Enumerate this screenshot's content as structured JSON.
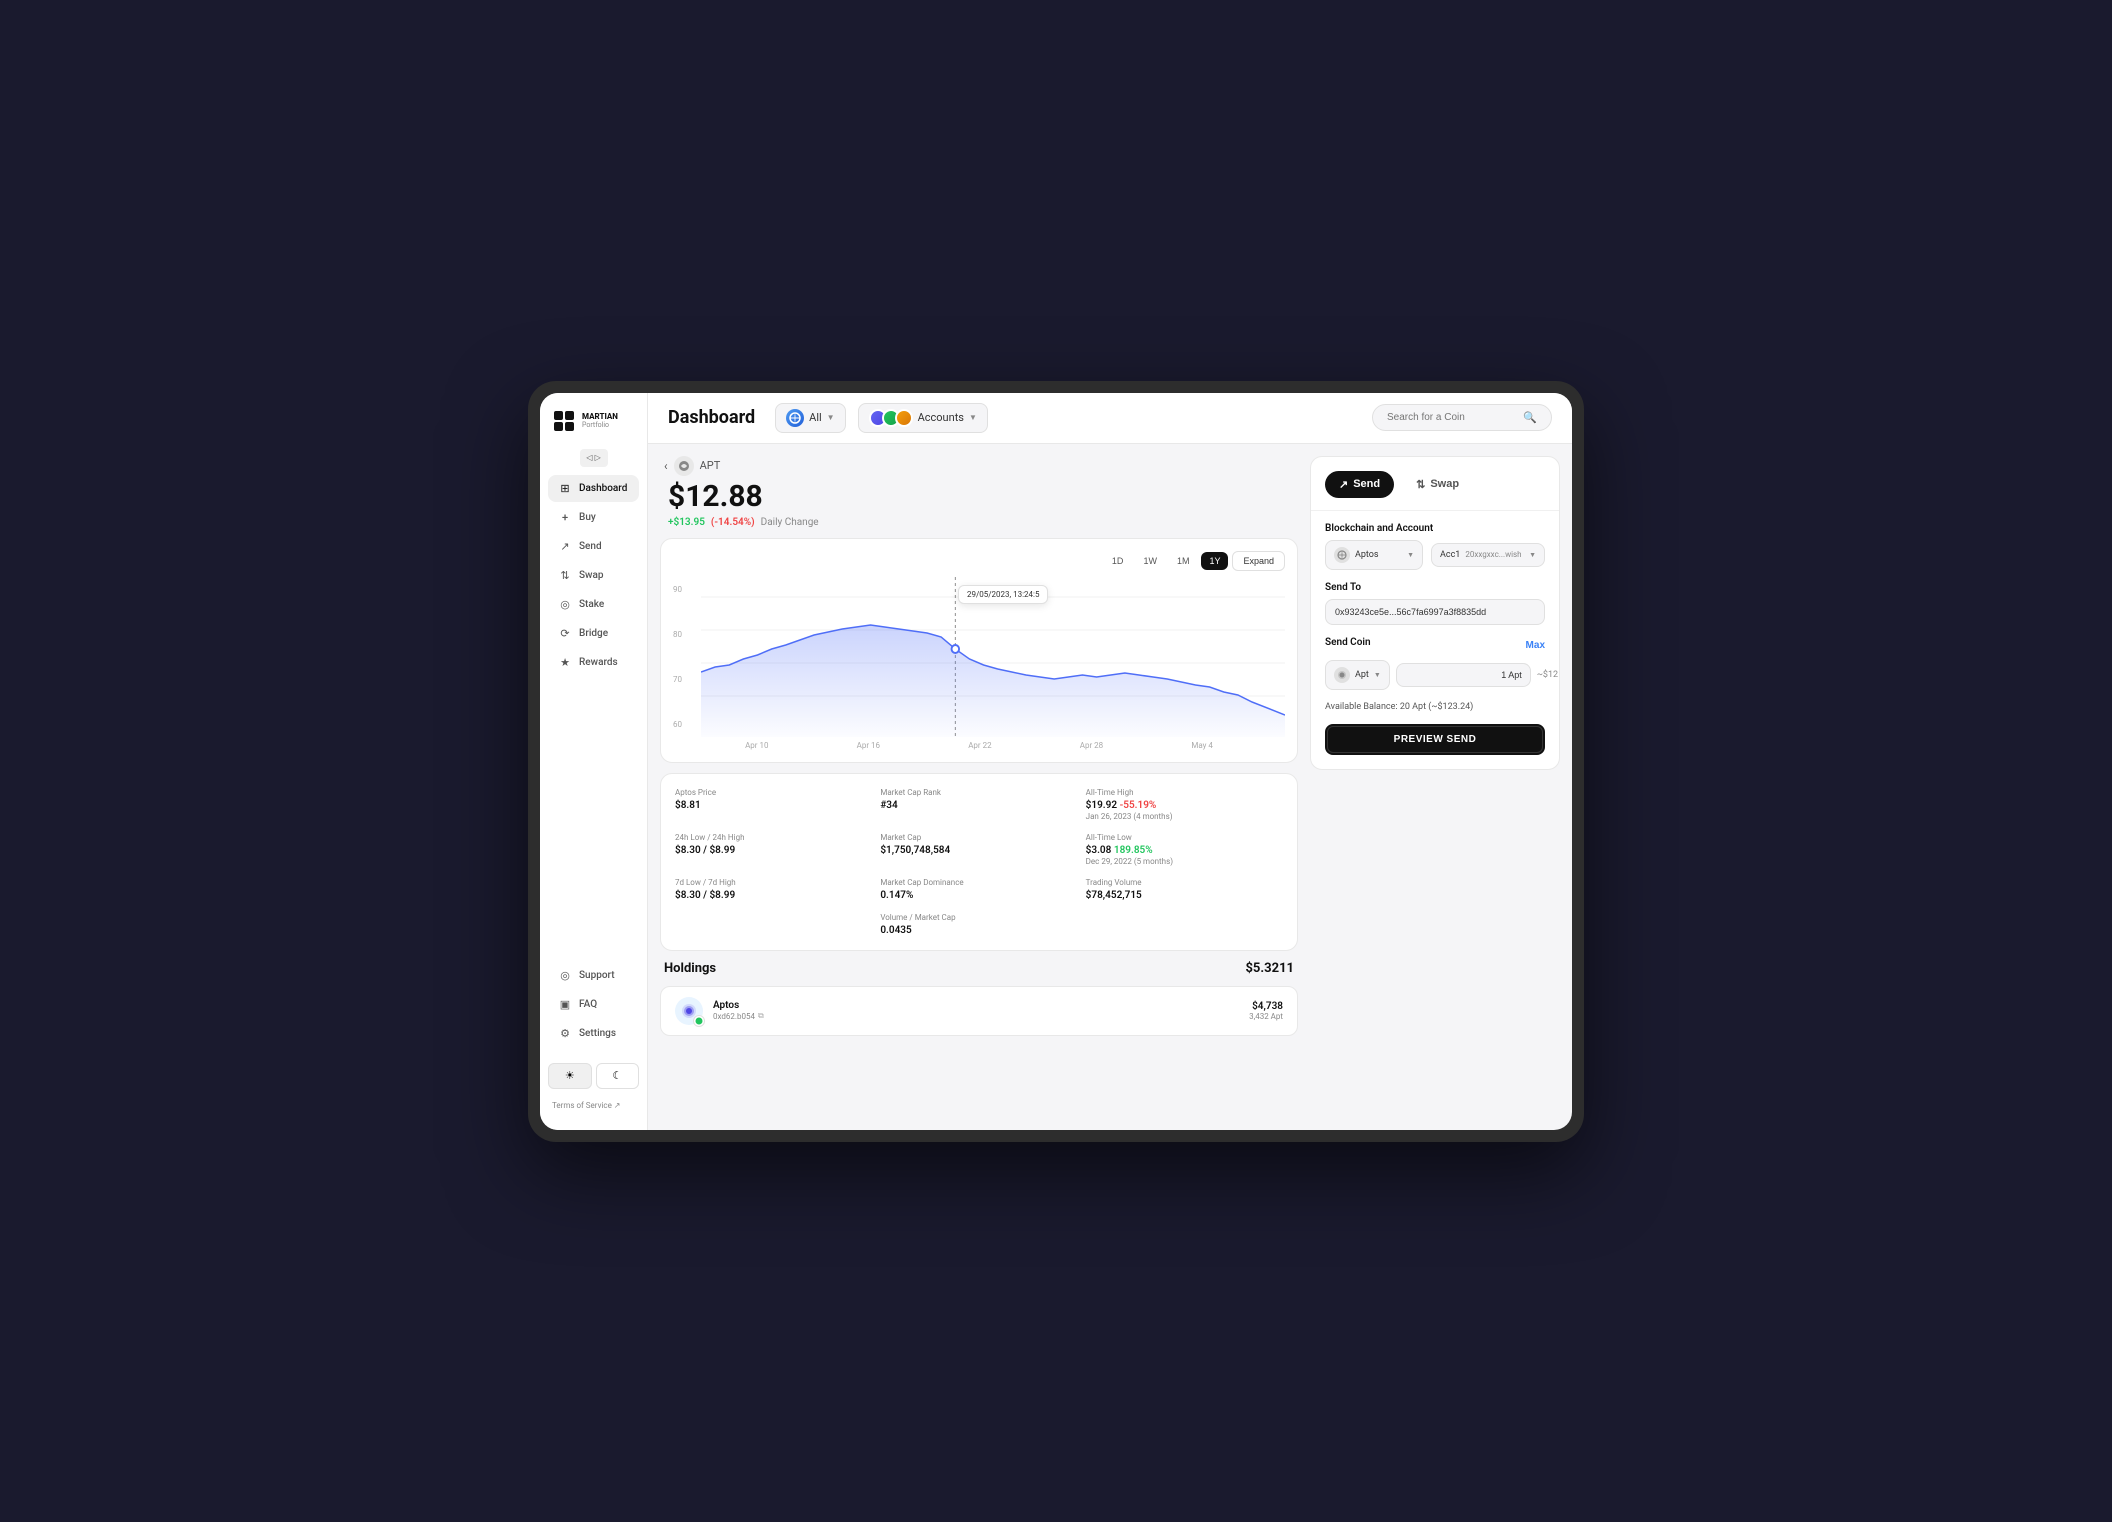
{
  "app": {
    "name": "MARTIAN",
    "subtitle": "Portfolio"
  },
  "header": {
    "title": "Dashboard",
    "network_label": "All",
    "accounts_label": "Accounts",
    "search_placeholder": "Search for a Coin"
  },
  "sidebar": {
    "nav_items": [
      {
        "id": "dashboard",
        "label": "Dashboard",
        "icon": "⊞",
        "active": true
      },
      {
        "id": "buy",
        "label": "Buy",
        "icon": "+",
        "active": false
      },
      {
        "id": "send",
        "label": "Send",
        "icon": "↗",
        "active": false
      },
      {
        "id": "swap",
        "label": "Swap",
        "icon": "⇅",
        "active": false
      },
      {
        "id": "stake",
        "label": "Stake",
        "icon": "%",
        "active": false
      },
      {
        "id": "bridge",
        "label": "Bridge",
        "icon": "⟳",
        "active": false
      },
      {
        "id": "rewards",
        "label": "Rewards",
        "icon": "★",
        "active": false
      }
    ],
    "bottom_items": [
      {
        "id": "support",
        "label": "Support",
        "icon": "◎"
      },
      {
        "id": "faq",
        "label": "FAQ",
        "icon": "▣"
      },
      {
        "id": "settings",
        "label": "Settings",
        "icon": "⚙"
      }
    ],
    "terms_label": "Terms of Service ↗"
  },
  "coin": {
    "symbol": "APT",
    "price": "$12.88",
    "change_amount": "+$13.95",
    "change_pct": "(-14.54%)",
    "change_label": "Daily Change"
  },
  "chart": {
    "tooltip_date": "29/05/2023, 13:24:5",
    "y_labels": [
      "90",
      "80",
      "70",
      "60"
    ],
    "x_labels": [
      "Apr 10",
      "Apr 16",
      "Apr 22",
      "Apr 28",
      "May 4"
    ],
    "time_buttons": [
      "1D",
      "1W",
      "1M",
      "1Y"
    ],
    "active_time": "1Y",
    "expand_label": "Expand"
  },
  "stats": {
    "aptos_price_label": "Aptos Price",
    "aptos_price_value": "$8.81",
    "market_cap_rank_label": "Market Cap Rank",
    "market_cap_rank_value": "#34",
    "all_time_high_label": "All-Time High",
    "all_time_high_value": "$19.92",
    "all_time_high_change": "-55.19%",
    "all_time_high_date": "Jan 26, 2023 (4 months)",
    "low_24h_label": "24h Low / 24h High",
    "low_24h_value": "$8.30 / $8.99",
    "market_cap_label": "Market Cap",
    "market_cap_value": "$1,750,748,584",
    "all_time_low_label": "All-Time Low",
    "all_time_low_value": "$3.08",
    "all_time_low_change": "189.85%",
    "all_time_low_date": "Dec 29, 2022 (5 months)",
    "low_7d_label": "7d Low / 7d High",
    "low_7d_value": "$8.30 / $8.99",
    "market_cap_dominance_label": "Market Cap Dominance",
    "market_cap_dominance_value": "0.147%",
    "trading_volume_label": "Trading Volume",
    "trading_volume_value": "$78,452,715",
    "volume_market_cap_label": "Volume / Market Cap",
    "volume_market_cap_value": "0.0435"
  },
  "holdings": {
    "title": "Holdings",
    "total_value": "$5.3211",
    "items": [
      {
        "name": "Aptos",
        "address": "0xd62.b054",
        "usd_value": "$4,738",
        "apt_amount": "3,432 Apt"
      }
    ]
  },
  "send_panel": {
    "send_label": "Send",
    "swap_label": "Swap",
    "section_title": "Blockchain and Account",
    "blockchain_name": "Aptos",
    "account_name": "Acc1",
    "account_address": "20xxgxxc...wish",
    "send_to_label": "Send To",
    "send_to_address": "0x93243ce5e...56c7fa6997a3f8835dd",
    "send_coin_label": "Send Coin",
    "max_label": "Max",
    "coin_label": "Apt",
    "amount_value": "1 Apt",
    "usd_equiv": "~$12",
    "available_balance": "Available Balance: 20 Apt (~$123.24)",
    "preview_btn_label": "PREVIEW SEND"
  }
}
